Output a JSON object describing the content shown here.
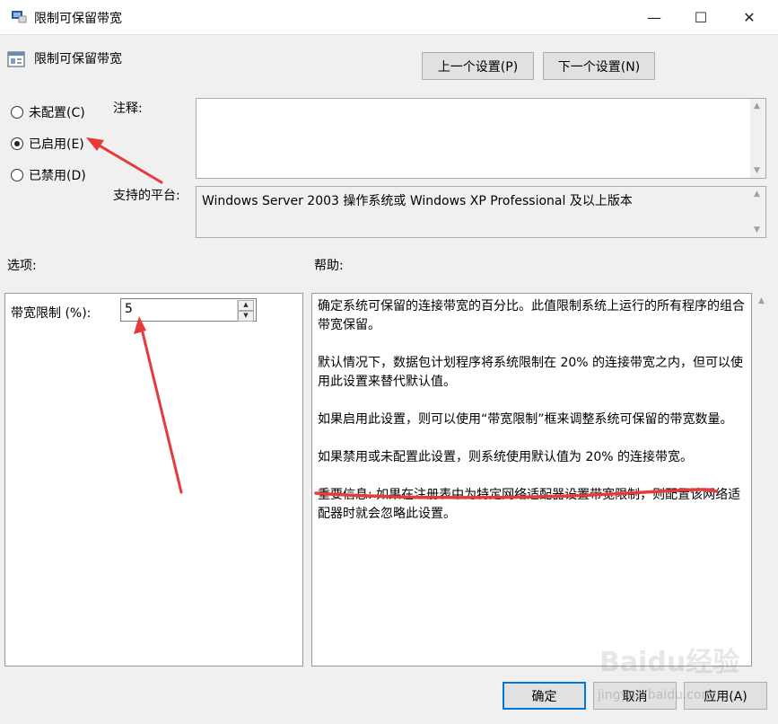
{
  "window": {
    "title": "限制可保留带宽",
    "minimize": "—",
    "maximize": "☐",
    "close": "✕"
  },
  "header": {
    "policy_name": "限制可保留带宽",
    "prev_button": "上一个设置(P)",
    "next_button": "下一个设置(N)"
  },
  "state": {
    "options": [
      {
        "label": "未配置(C)",
        "selected": false
      },
      {
        "label": "已启用(E)",
        "selected": true
      },
      {
        "label": "已禁用(D)",
        "selected": false
      }
    ]
  },
  "comment": {
    "label": "注释:",
    "value": ""
  },
  "platform": {
    "label": "支持的平台:",
    "value": "Windows Server 2003 操作系统或 Windows XP Professional 及以上版本"
  },
  "options_section": {
    "label": "选项:",
    "bandwidth_label": "带宽限制 (%):",
    "bandwidth_value": "5"
  },
  "help_section": {
    "label": "帮助:",
    "paragraphs": [
      "确定系统可保留的连接带宽的百分比。此值限制系统上运行的所有程序的组合带宽保留。",
      "默认情况下，数据包计划程序将系统限制在 20% 的连接带宽之内，但可以使用此设置来替代默认值。",
      "如果启用此设置，则可以使用“带宽限制”框来调整系统可保留的带宽数量。",
      "如果禁用或未配置此设置，则系统使用默认值为 20% 的连接带宽。",
      "重要信息: 如果在注册表中为特定网络适配器设置带宽限制，则配置该网络适配器时就会忽略此设置。"
    ]
  },
  "footer": {
    "ok": "确定",
    "cancel": "取消",
    "apply": "应用(A)"
  },
  "watermark": {
    "brand": "Baidu经验",
    "url": "jingyan.baidu.com"
  },
  "colors": {
    "annotation": "#e8393b",
    "accent": "#0078d7"
  }
}
